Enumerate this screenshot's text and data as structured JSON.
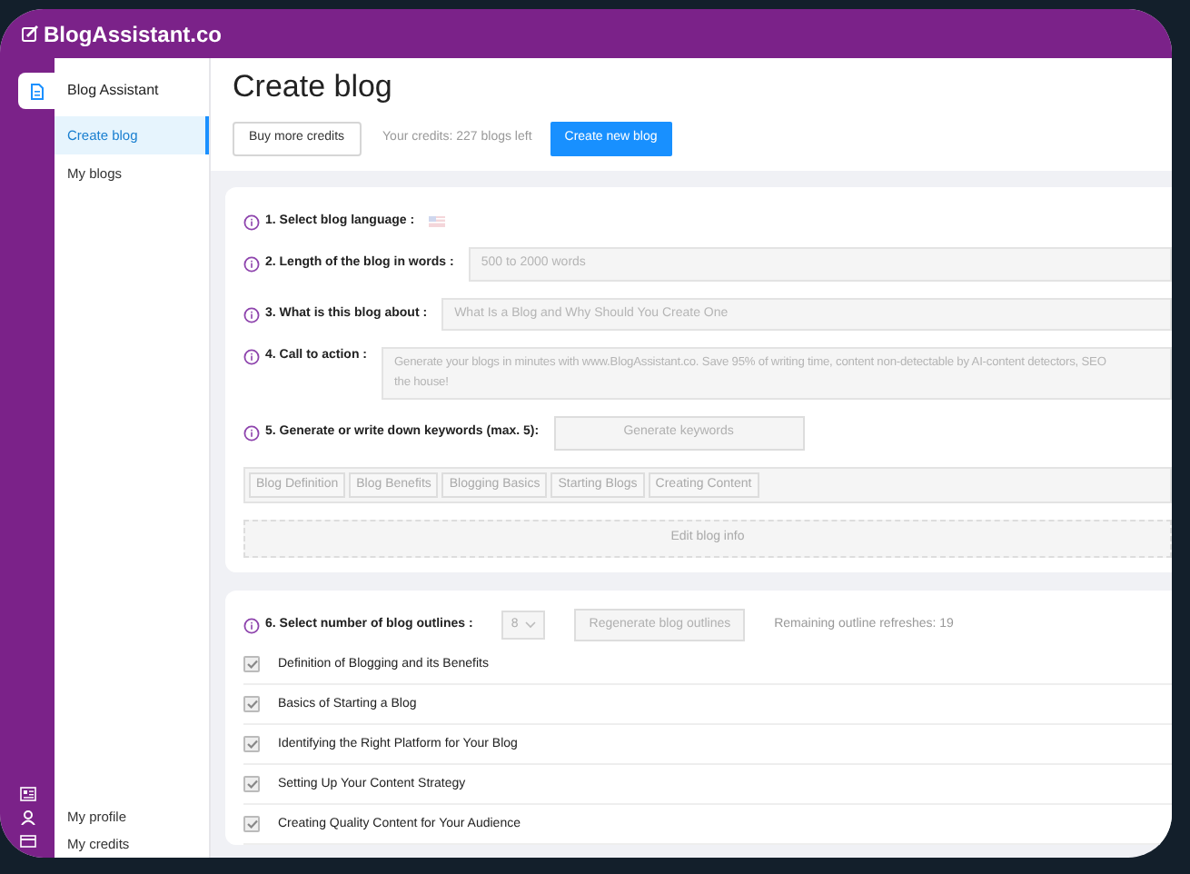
{
  "header": {
    "logo": "BlogAssistant.co"
  },
  "sidebar": {
    "title": "Blog Assistant",
    "items": [
      {
        "label": "Create blog",
        "selected": true
      },
      {
        "label": "My blogs",
        "selected": false
      }
    ],
    "footer_items": [
      {
        "label": "My profile"
      },
      {
        "label": "My credits"
      }
    ]
  },
  "main": {
    "title": "Create blog",
    "buy_button": "Buy more credits",
    "credits": "Your credits: 227 blogs left",
    "create_button": "Create new blog"
  },
  "form": {
    "steps": [
      {
        "kind": "language",
        "label": "1. Select blog language :"
      },
      {
        "kind": "field",
        "label": "2. Length of the blog in words :",
        "value": "500 to 2000 words"
      },
      {
        "kind": "field",
        "label": "3. What is this blog about :",
        "value": "What Is a Blog and Why Should You Create One"
      },
      {
        "kind": "textarea",
        "label": "4. Call to action :",
        "lines": [
          "Generate your blogs in minutes with www.BlogAssistant.co. Save 95% of writing time, content non-detectable by AI-content detectors, SEO",
          "the house!"
        ]
      },
      {
        "kind": "keywords",
        "label": "5. Generate or write down keywords (max. 5):",
        "button": "Generate keywords"
      }
    ],
    "keywords": [
      "Blog Definition",
      "Blog Benefits",
      "Blogging Basics",
      "Starting Blogs",
      "Creating Content"
    ],
    "edit_button": "Edit blog info"
  },
  "outlines": {
    "label": "6. Select number of blog outlines :",
    "count": "8",
    "regenerate_button": "Regenerate blog outlines",
    "remaining": "Remaining outline refreshes: 19",
    "items": [
      {
        "label": "Definition of Blogging and its Benefits",
        "checked": true
      },
      {
        "label": "Basics of Starting a Blog",
        "checked": true
      },
      {
        "label": "Identifying the Right Platform for Your Blog",
        "checked": true
      },
      {
        "label": "Setting Up Your Content Strategy",
        "checked": true
      },
      {
        "label": "Creating Quality Content for Your Audience",
        "checked": true
      }
    ]
  }
}
